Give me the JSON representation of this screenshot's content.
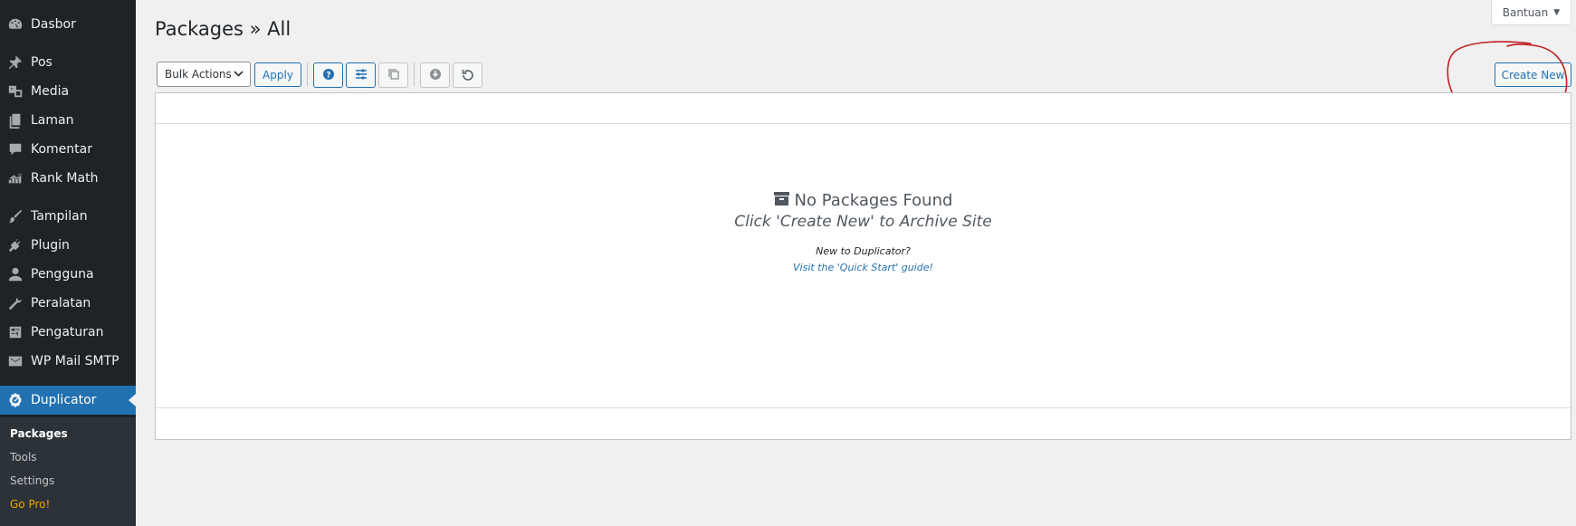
{
  "colors": {
    "sidebar_bg": "#1d2327",
    "active_bg": "#2271b1",
    "accent": "#2271b1",
    "gopro": "#f0a000",
    "annotation": "#c0201e"
  },
  "header": {
    "title": "Packages » All",
    "help_label": "Bantuan"
  },
  "sidebar": {
    "items": [
      {
        "label": "Dasbor",
        "icon": "dashboard-icon"
      },
      {
        "label": "Pos",
        "icon": "pin-icon"
      },
      {
        "label": "Media",
        "icon": "media-icon"
      },
      {
        "label": "Laman",
        "icon": "pages-icon"
      },
      {
        "label": "Komentar",
        "icon": "comment-icon"
      },
      {
        "label": "Rank Math",
        "icon": "chart-icon"
      },
      {
        "label": "Tampilan",
        "icon": "brush-icon"
      },
      {
        "label": "Plugin",
        "icon": "plugin-icon"
      },
      {
        "label": "Pengguna",
        "icon": "user-icon"
      },
      {
        "label": "Peralatan",
        "icon": "wrench-icon"
      },
      {
        "label": "Pengaturan",
        "icon": "settings-icon"
      },
      {
        "label": "WP Mail SMTP",
        "icon": "mail-icon"
      },
      {
        "label": "Duplicator",
        "icon": "duplicator-icon",
        "active": true
      }
    ],
    "submenu": [
      {
        "label": "Packages",
        "current": true
      },
      {
        "label": "Tools"
      },
      {
        "label": "Settings"
      },
      {
        "label": "Go Pro!"
      }
    ]
  },
  "toolbar": {
    "bulk_actions": "Bulk Actions",
    "apply": "Apply",
    "icons": [
      "help-icon",
      "filter-icon",
      "copy-icon",
      "download-icon",
      "undo-icon"
    ],
    "create_new": "Create New"
  },
  "empty_state": {
    "title": "No Packages Found",
    "subtitle": "Click 'Create New' to Archive Site",
    "question": "New to Duplicator?",
    "link": "Visit the 'Quick Start' guide!"
  }
}
